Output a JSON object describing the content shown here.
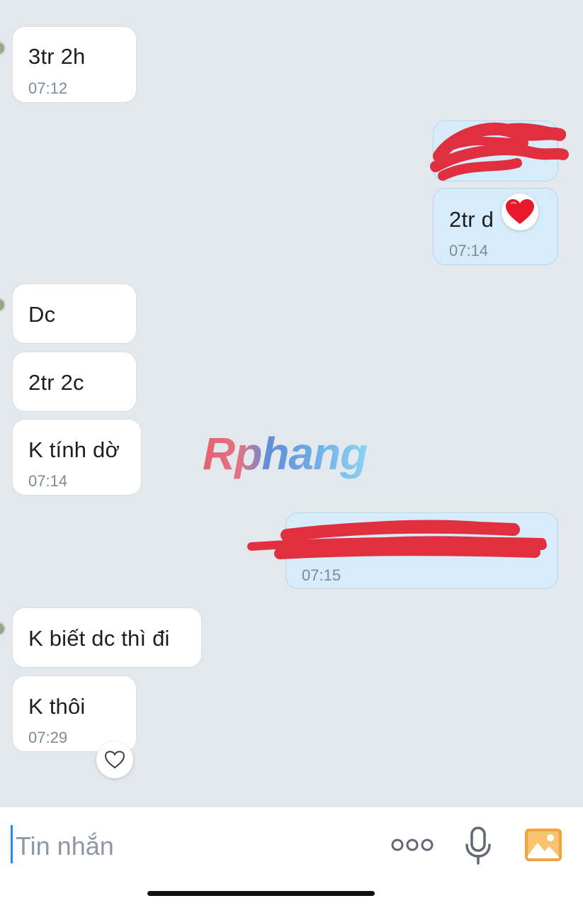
{
  "messages": [
    {
      "direction": "in",
      "text": "3tr 2h",
      "time": "07:12"
    },
    {
      "direction": "out",
      "text": "",
      "redacted": true
    },
    {
      "direction": "out",
      "text": "2tr d",
      "time": "07:14",
      "reaction": "red-heart-icon"
    },
    {
      "direction": "in",
      "text": "Dc"
    },
    {
      "direction": "in",
      "text": "2tr 2c"
    },
    {
      "direction": "in",
      "text": "K tính dờ",
      "time": "07:14"
    },
    {
      "direction": "out",
      "text": "",
      "redacted": true,
      "time": "07:15"
    },
    {
      "direction": "in",
      "text": "K biết dc thì đi"
    },
    {
      "direction": "in",
      "text": "K thôi",
      "time": "07:29",
      "reaction": "heart-outline-icon"
    }
  ],
  "watermark": "Rphang",
  "composer": {
    "placeholder": "Tin nhắn",
    "more_icon": "more-dots-icon",
    "voice_icon": "microphone-icon",
    "image_icon": "image-gallery-icon"
  },
  "colors": {
    "chat_background": "#e3e8ee",
    "incoming_bubble": "#ffffff",
    "outgoing_bubble": "#d6ecfb",
    "timestamp": "#7f8a96",
    "redaction": "#e0303f",
    "accent": "#1a8cff",
    "image_icon": "#f5a23a"
  }
}
